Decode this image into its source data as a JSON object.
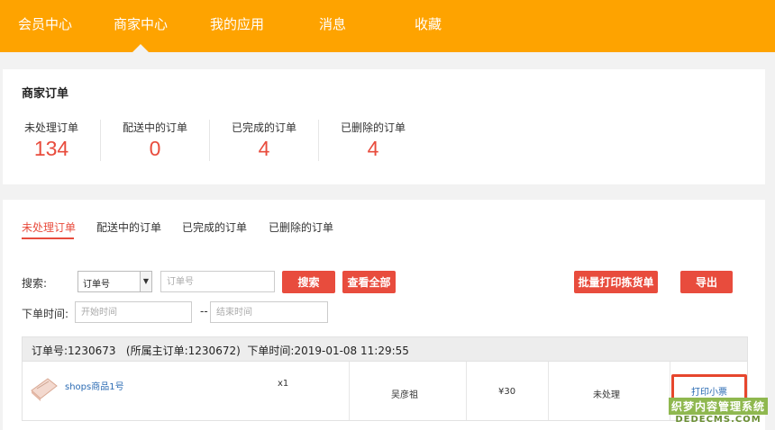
{
  "nav": {
    "items": [
      "会员中心",
      "商家中心",
      "我的应用",
      "消息",
      "收藏"
    ],
    "active": "商家中心"
  },
  "summary": {
    "title": "商家订单",
    "stats": [
      {
        "label": "未处理订单",
        "value": "134"
      },
      {
        "label": "配送中的订单",
        "value": "0"
      },
      {
        "label": "已完成的订单",
        "value": "4"
      },
      {
        "label": "已删除的订单",
        "value": "4"
      }
    ]
  },
  "orders": {
    "tabs": [
      "未处理订单",
      "配送中的订单",
      "已完成的订单",
      "已删除的订单"
    ],
    "active_tab": "未处理订单",
    "search": {
      "label": "搜索:",
      "type_selected": "订单号",
      "keyword_placeholder": "订单号",
      "search_button": "搜索",
      "view_all_button": "查看全部",
      "batch_print_button": "批量打印拣货单",
      "export_button": "导出"
    },
    "date_filter": {
      "label": "下单时间:",
      "start_placeholder": "开始时间",
      "separator": "--",
      "end_placeholder": "结束时间"
    },
    "order": {
      "header_text": "订单号:1230673   (所属主订单:1230672)  下单时间:2019-01-08 11:29:55",
      "product_name": "shops商品1号",
      "quantity": "x1",
      "buyer": "吴彦祖",
      "price": "¥30",
      "status": "未处理",
      "print_receipt": "打印小票"
    }
  },
  "watermark": {
    "main": "织梦内容管理系统",
    "sub": "DEDECMS.COM"
  },
  "colors": {
    "nav_bg": "#fea300",
    "accent_red": "#e84c3d",
    "link_blue": "#2b6bb3"
  }
}
